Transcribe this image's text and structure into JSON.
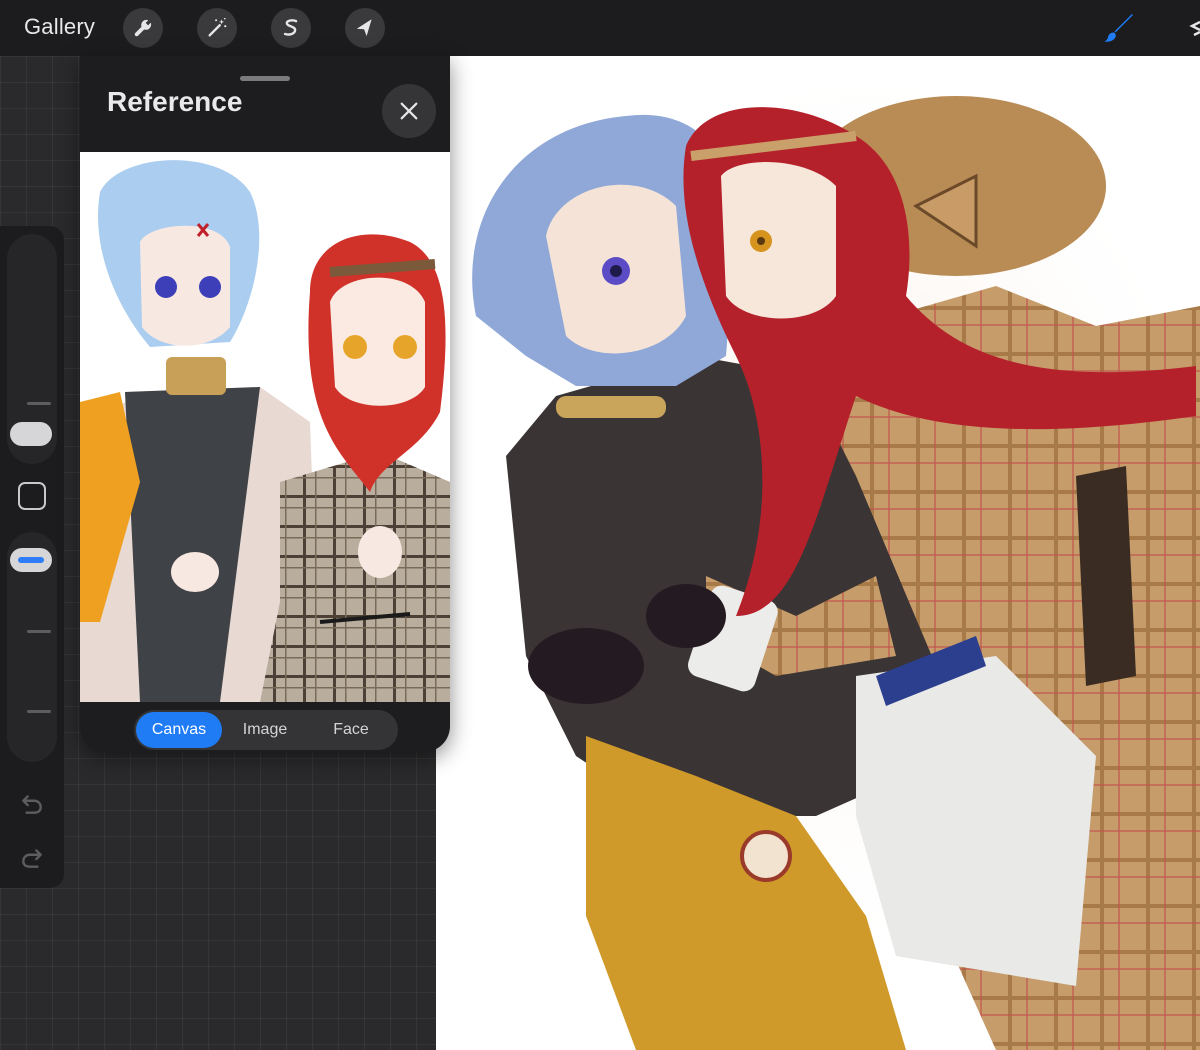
{
  "topbar": {
    "gallery_label": "Gallery",
    "tools": [
      {
        "name": "actions",
        "icon": "wrench-icon"
      },
      {
        "name": "adjustments",
        "icon": "magic-wand-icon"
      },
      {
        "name": "selection",
        "icon": "selection-s-icon"
      },
      {
        "name": "transform",
        "icon": "arrow-cursor-icon"
      }
    ],
    "active_tool": {
      "name": "brush",
      "icon": "brush-icon",
      "color": "#1f7cf5"
    }
  },
  "reference_panel": {
    "title": "Reference",
    "close_icon": "close-icon",
    "tabs": [
      {
        "label": "Canvas",
        "active": true
      },
      {
        "label": "Image",
        "active": false
      },
      {
        "label": "Face",
        "active": false
      }
    ],
    "accent_color": "#1f7cf5"
  },
  "sidebar": {
    "brush_size_icon": "slider-thumb",
    "modify_icon": "square-icon",
    "opacity_icon": "slider-thumb",
    "undo_icon": "undo-icon",
    "redo_icon": "redo-icon"
  },
  "colors": {
    "background": "#2a2a2c",
    "panel": "#1d1d1f",
    "canvas": "#ffffff",
    "accent": "#1f7cf5"
  }
}
